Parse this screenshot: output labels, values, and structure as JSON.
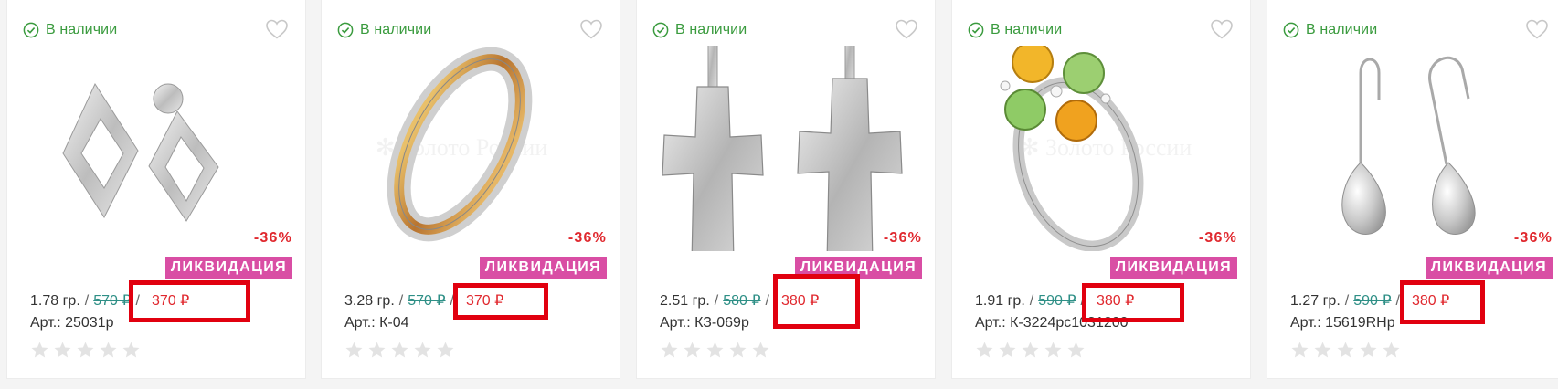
{
  "cards": [
    {
      "stock": "В наличии",
      "discount": "-36%",
      "badge": "ЛИКВИДАЦИЯ",
      "weight": "1.78 гр.",
      "sep": "/",
      "old_price": "570 ₽",
      "new_price": "370 ₽",
      "sku": "Арт.: 25031р",
      "rating_stars": 0
    },
    {
      "stock": "В наличии",
      "discount": "-36%",
      "badge": "ЛИКВИДАЦИЯ",
      "weight": "3.28 гр.",
      "sep": "/",
      "old_price": "570 ₽",
      "new_price": "370 ₽",
      "sku": "Арт.: К-04",
      "rating_stars": 0
    },
    {
      "stock": "В наличии",
      "discount": "-36%",
      "badge": "ЛИКВИДАЦИЯ",
      "weight": "2.51 гр.",
      "sep": "/",
      "old_price": "580 ₽",
      "new_price": "380 ₽",
      "sku": "Арт.: КЗ-069р",
      "rating_stars": 0
    },
    {
      "stock": "В наличии",
      "discount": "-36%",
      "badge": "ЛИКВИДАЦИЯ",
      "weight": "1.91 гр.",
      "sep": "/",
      "old_price": "590 ₽",
      "new_price": "380 ₽",
      "sku": "Арт.: К-3224рс1031200",
      "rating_stars": 0
    },
    {
      "stock": "В наличии",
      "discount": "-36%",
      "badge": "ЛИКВИДАЦИЯ",
      "weight": "1.27 гр.",
      "sep": "/",
      "old_price": "590 ₽",
      "new_price": "380 ₽",
      "sku": "Арт.: 15619RHр",
      "rating_stars": 0
    }
  ],
  "colors": {
    "in_stock": "#3a9b3e",
    "old_price": "#2e8f86",
    "new_price": "#e0282e",
    "badge_bg": "#d94ea4",
    "highlight": "#e1000f"
  },
  "icons": [
    "check-circle-icon",
    "heart-icon",
    "star-icon"
  ]
}
